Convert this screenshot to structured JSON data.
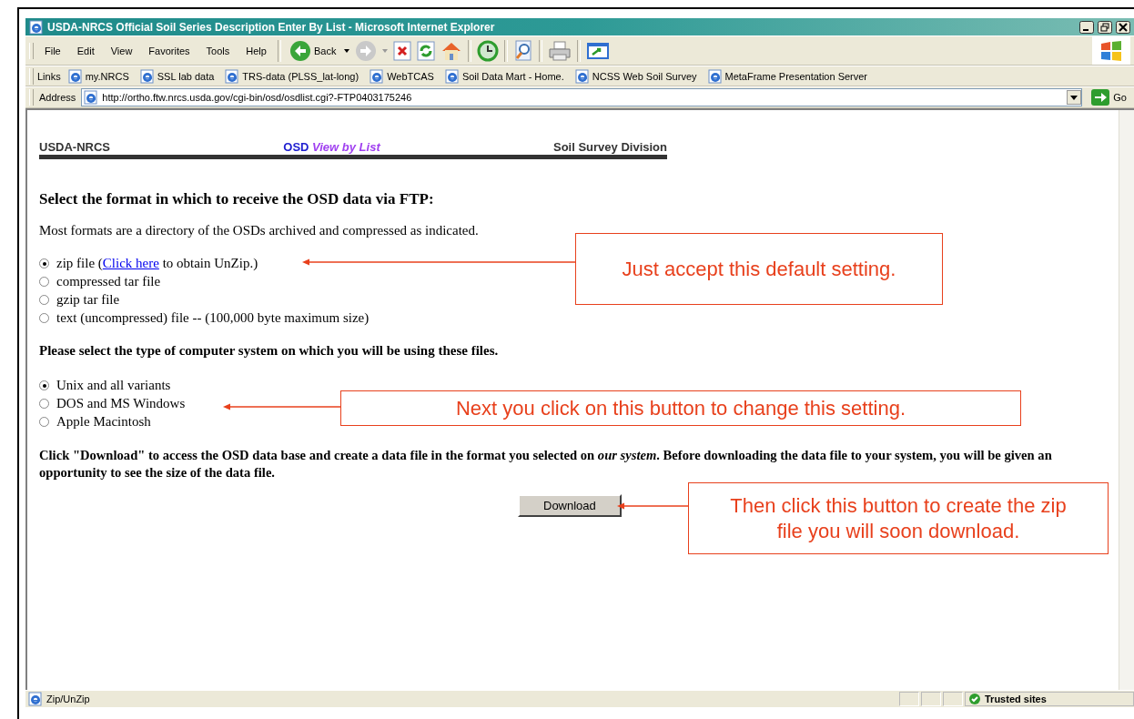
{
  "window": {
    "title": "USDA-NRCS Official Soil Series Description Enter By List - Microsoft Internet Explorer"
  },
  "menu": [
    "File",
    "Edit",
    "View",
    "Favorites",
    "Tools",
    "Help"
  ],
  "toolbar": {
    "back_label": "Back"
  },
  "links": {
    "label": "Links",
    "items": [
      "my.NRCS",
      "SSL lab data",
      "TRS-data (PLSS_lat-long)",
      "WebTCAS",
      "Soil Data Mart - Home.",
      "NCSS Web Soil Survey",
      "MetaFrame Presentation Server"
    ]
  },
  "address": {
    "label": "Address",
    "value": "http://ortho.ftw.nrcs.usda.gov/cgi-bin/osd/osdlist.cgi?-FTP0403175246",
    "go": "Go"
  },
  "page": {
    "header": {
      "left": "USDA-NRCS",
      "brand": "OSD",
      "subtitle": "View by List",
      "right": "Soil Survey Division"
    },
    "format_heading": "Select the format in which to receive the OSD data via FTP:",
    "format_intro": "Most formats are a directory of the OSDs archived and compressed as indicated.",
    "format_options": [
      {
        "text": "zip file (",
        "link": "Click here",
        "text_after": " to obtain UnZip.)",
        "selected": true
      },
      {
        "text": "compressed tar file",
        "selected": false
      },
      {
        "text": "gzip tar file",
        "selected": false
      },
      {
        "text": "text (uncompressed) file -- (100,000 byte maximum size)",
        "selected": false
      }
    ],
    "system_heading": "Please select the type of computer system on which you will be using these files.",
    "system_options": [
      {
        "text": "Unix and all variants",
        "selected": true
      },
      {
        "text": "DOS and MS Windows",
        "selected": false
      },
      {
        "text": "Apple Macintosh",
        "selected": false
      }
    ],
    "download_note": "Click \"Download\" to access the OSD data base and create a data file in the format you selected on *our system*. Before downloading the data file to your system, you will be given an opportunity to see the size of the data file.",
    "download_button": "Download"
  },
  "annotations": [
    {
      "text": "Just accept this default setting."
    },
    {
      "text": "Next you click on this button to change this setting."
    },
    {
      "text": "Then click this button to create the zip file you will soon download."
    }
  ],
  "status_bar": {
    "text": "Zip/UnZip",
    "zone": "Trusted sites"
  }
}
